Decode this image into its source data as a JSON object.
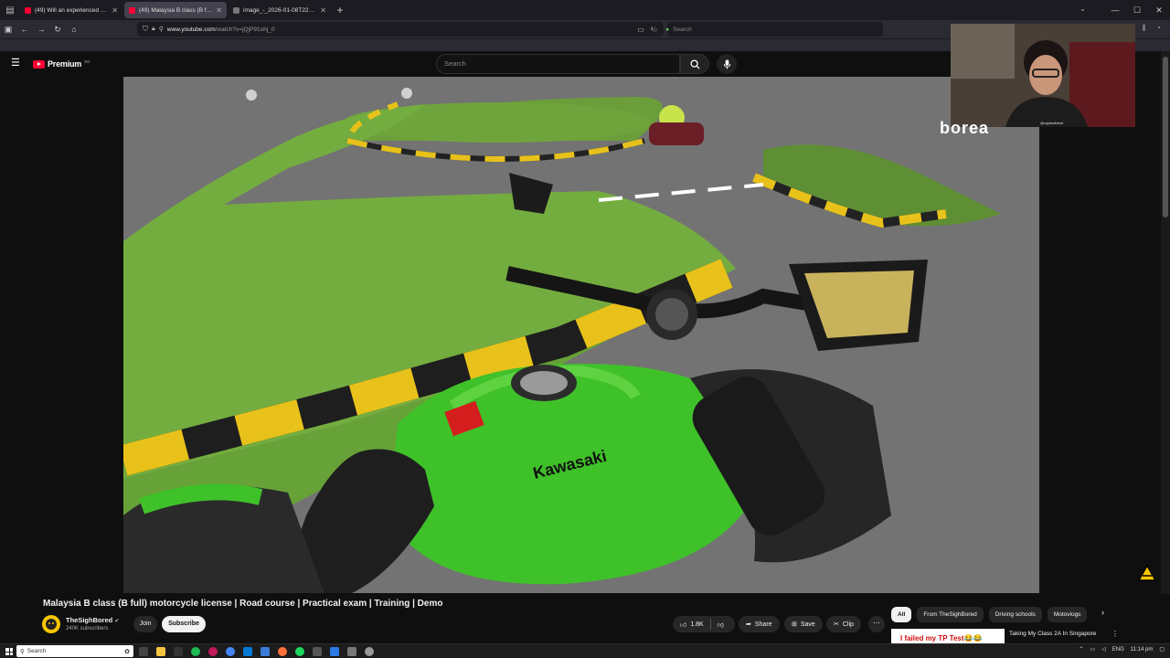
{
  "browser": {
    "tabs": [
      {
        "label": "(49) Will an experienced rider p",
        "active": false
      },
      {
        "label": "(49) Malaysia B class (B full)",
        "active": true
      },
      {
        "label": "image_-_2026-01-08T225916.570.jp",
        "active": false
      }
    ],
    "new_tab_icon": "+",
    "url_domain": "www.youtube.com",
    "url_path": "/watch?v=jQjP91ohj_0",
    "search_placeholder": "Search"
  },
  "youtube": {
    "logo_text": "Premium",
    "logo_country": "SG",
    "search_placeholder": "Search"
  },
  "video": {
    "title": "Malaysia B class (B full) motorcycle license | Road course | Practical exam | Training | Demo",
    "channel_name": "TheSighBored",
    "subscribers": "240K subscribers",
    "join_label": "Join",
    "subscribe_label": "Subscribe",
    "likes": "1.8K",
    "share_label": "Share",
    "save_label": "Save",
    "clip_label": "Clip",
    "more_label": "⋯",
    "tank_brand": "Kawasaki",
    "webcam_caption": "@rajakwibbolt",
    "webcam_overlay_text": "borea"
  },
  "chips": [
    "All",
    "From TheSighBored",
    "Driving schools",
    "Motovlogs"
  ],
  "recommendation": {
    "thumb_text": "I failed my TP Test😂😂",
    "title": "Taking My Class 2A In Singapore"
  },
  "taskbar": {
    "search_label": "Search",
    "lang": "ENG",
    "time": "11:14 pm"
  },
  "colors": {
    "yt_red": "#ff0033",
    "bike_green": "#3fc12a",
    "curb_yellow": "#e8c21a"
  }
}
